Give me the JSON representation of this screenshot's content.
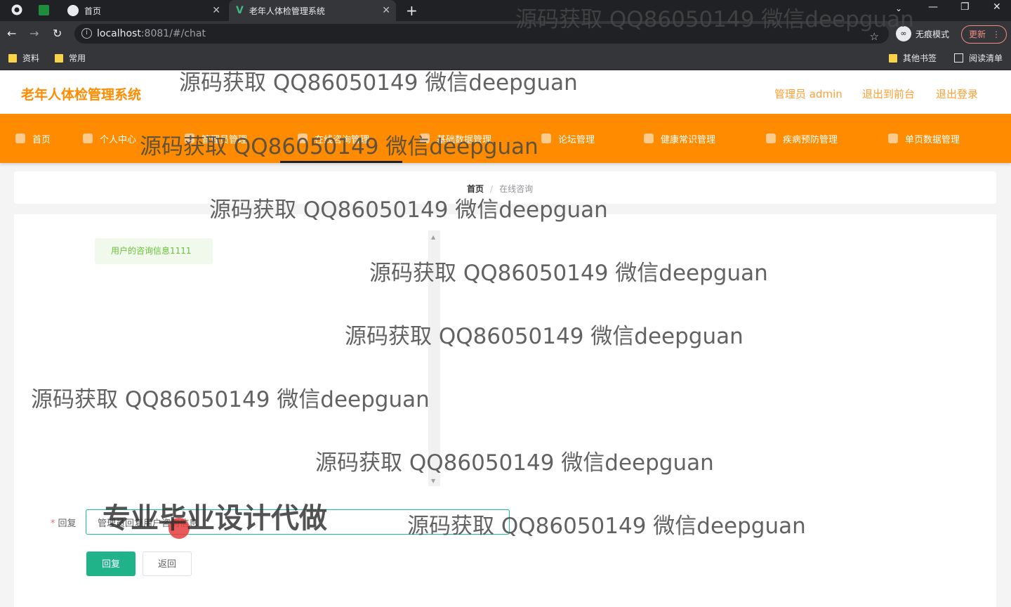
{
  "browser": {
    "tabs": [
      {
        "label": "首页",
        "active": false
      },
      {
        "label": "老年人体检管理系统",
        "active": true
      }
    ],
    "new_tab": "+",
    "url_host": "localhost",
    "url_path": ":8081/#/chat",
    "profile_label": "无痕模式",
    "update_label": "更新",
    "bookmarks": [
      "资料",
      "常用"
    ],
    "bookmarks_right": [
      "其他书签",
      "阅读清单"
    ]
  },
  "header": {
    "title": "老年人体检管理系统",
    "user_label": "管理员 admin",
    "to_front_label": "退出到前台",
    "logout_label": "退出登录"
  },
  "nav": {
    "items": [
      "首页",
      "个人中心",
      "管理员管理",
      "在线咨询管理",
      "基础数据管理",
      "论坛管理",
      "健康常识管理",
      "疾病预防管理",
      "单页数据管理"
    ],
    "active_index": 3
  },
  "breadcrumb": {
    "home": "首页",
    "separator": "/",
    "current": "在线咨询"
  },
  "chat": {
    "messages": [
      {
        "text": "用户的咨询信息1111"
      }
    ]
  },
  "form": {
    "required_mark": "*",
    "reply_label": "回复",
    "reply_value": "管理员回复用户咨询信息",
    "submit_label": "回复",
    "back_label": "返回"
  },
  "watermark": {
    "text": "源码获取 QQ86050149 微信deepguan",
    "banner": "专业毕业设计代做"
  },
  "colors": {
    "accent": "#ff8c00",
    "primary_button": "#20b38a",
    "input_border": "#1abc9c",
    "bubble_text": "#67c23a"
  }
}
